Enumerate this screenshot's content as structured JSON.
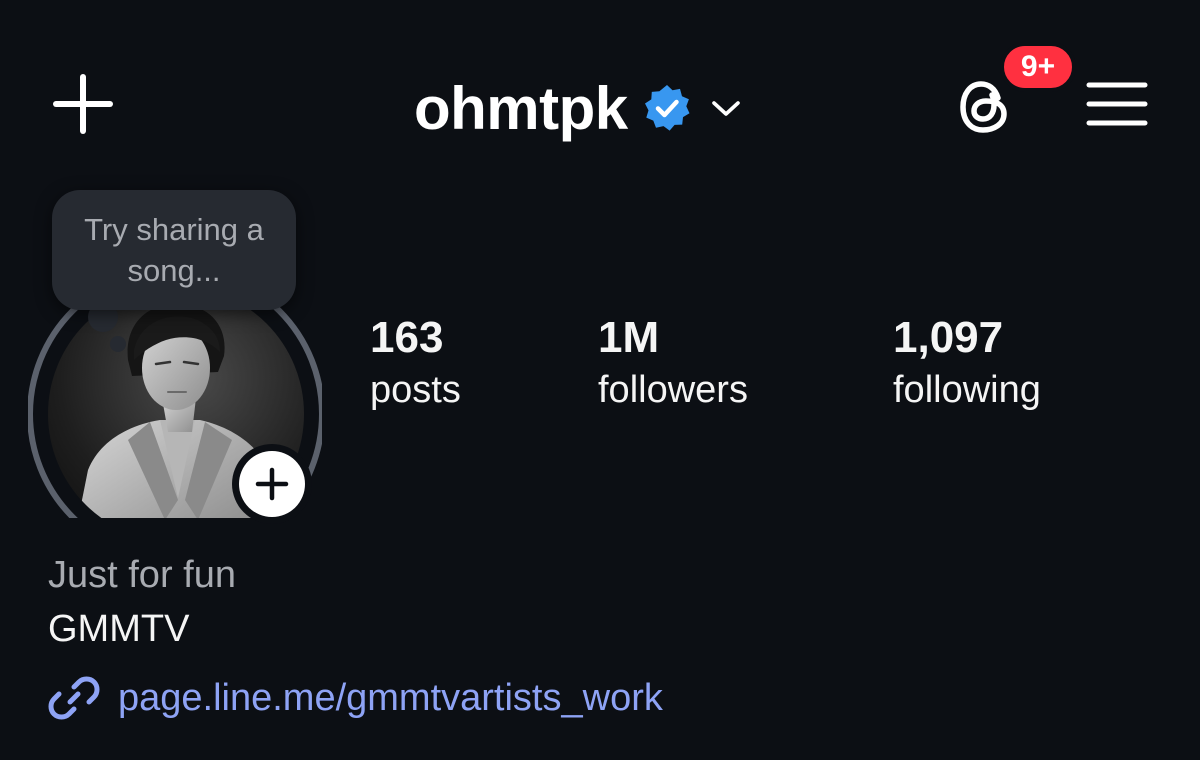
{
  "header": {
    "username": "ohmtpk",
    "notifications_badge": "9+",
    "icons": {
      "create": "plus-icon",
      "verified": "verified-badge-icon",
      "switch_account": "chevron-down-icon",
      "threads": "threads-icon",
      "menu": "hamburger-menu-icon"
    }
  },
  "note": {
    "prompt": "Try sharing a song..."
  },
  "stats": [
    {
      "value": "163",
      "label": "posts"
    },
    {
      "value": "1M",
      "label": "followers"
    },
    {
      "value": "1,097",
      "label": "following"
    }
  ],
  "bio": {
    "category": "Just for fun",
    "name": "GMMTV",
    "link": "page.line.me/gmmtvartists_work"
  },
  "colors": {
    "background": "#0c0f14",
    "badge": "#ff3040",
    "verified": "#3897f0",
    "link": "#8ea3f5",
    "muted_text": "#a8abb1",
    "bubble": "#262a31"
  }
}
